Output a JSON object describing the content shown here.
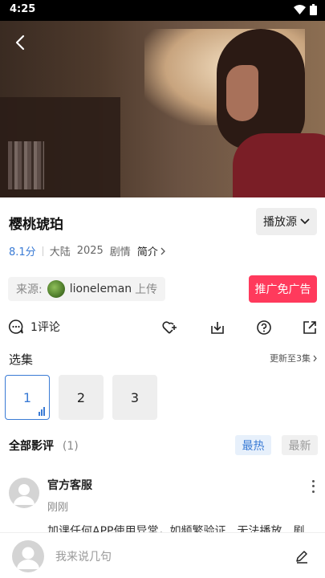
{
  "status_bar": {
    "time": "4:25",
    "icons": [
      "wifi-icon",
      "battery-icon"
    ]
  },
  "video": {
    "back_icon": "back-arrow-icon"
  },
  "title": "樱桃琥珀",
  "source_button": {
    "label": "播放源",
    "icon": "chevron-down-icon"
  },
  "meta": {
    "score": "8.1分",
    "region": "大陆",
    "year": "2025",
    "genre": "剧情",
    "intro_label": "简介"
  },
  "uploader": {
    "prefix": "来源:",
    "name": "lioneleman",
    "suffix": "上传"
  },
  "promo_button": "推广免广告",
  "actions": {
    "comment_count": "1评论",
    "icons": [
      "comment-icon",
      "favorite-add-icon",
      "download-icon",
      "help-icon",
      "share-icon"
    ]
  },
  "episodes": {
    "header": "选集",
    "update_text": "更新至3集",
    "items": [
      "1",
      "2",
      "3"
    ],
    "active": "1"
  },
  "reviews": {
    "title": "全部影评",
    "count": "(1)",
    "sort_hot": "最热",
    "sort_new": "最新",
    "items": [
      {
        "name": "官方客服",
        "time": "刚刚",
        "text": "加课任何APP使用异常，如频繁验证、无法播放、剧"
      }
    ]
  },
  "bottom_bar": {
    "placeholder": "我来说几句",
    "icon": "edit-icon"
  },
  "colors": {
    "accent": "#3a7bd5",
    "promo": "#ff3a5c",
    "status_bar": "#000000"
  }
}
